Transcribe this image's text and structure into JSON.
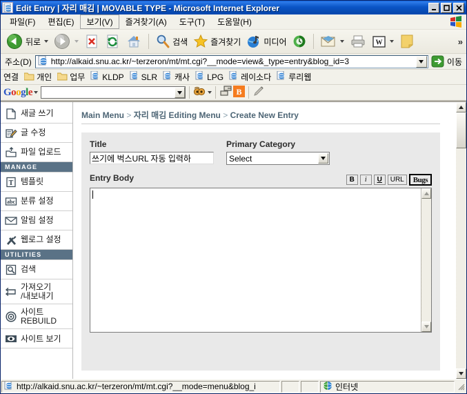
{
  "window": {
    "title": "Edit Entry | 자리 매김 | MOVABLE TYPE - Microsoft Internet Explorer",
    "icon": "ie-page-icon",
    "minimize": "_",
    "maximize": "□",
    "close": "✕"
  },
  "menubar": {
    "items": [
      {
        "label": "파일(F)",
        "selected": false
      },
      {
        "label": "편집(E)",
        "selected": false
      },
      {
        "label": "보기(V)",
        "selected": true
      },
      {
        "label": "즐겨찾기(A)",
        "selected": false
      },
      {
        "label": "도구(T)",
        "selected": false
      },
      {
        "label": "도움말(H)",
        "selected": false
      }
    ]
  },
  "toolbar": {
    "back": "뒤로",
    "forward": "",
    "stop": "",
    "refresh": "",
    "home": "",
    "search": "검색",
    "favorites": "즐겨찾기",
    "media": "미디어",
    "history": "",
    "mail": "",
    "print": "",
    "edit_word": "W",
    "notes": "",
    "overflow": "»"
  },
  "address": {
    "label": "주소(D)",
    "url": "http://alkaid.snu.ac.kr/~terzeron/mt/mt.cgi?__mode=view&_type=entry&blog_id=3",
    "go": "이동"
  },
  "links": {
    "label": "연결",
    "items": [
      {
        "label": "개인",
        "icon": "folder-icon"
      },
      {
        "label": "업무",
        "icon": "folder-icon"
      },
      {
        "label": "KLDP",
        "icon": "ie-page-icon"
      },
      {
        "label": "SLR",
        "icon": "ie-page-icon"
      },
      {
        "label": "캐사",
        "icon": "ie-page-icon"
      },
      {
        "label": "LPG",
        "icon": "ie-page-icon"
      },
      {
        "label": "레이소다",
        "icon": "ie-page-icon"
      },
      {
        "label": "루리웹",
        "icon": "ie-page-icon"
      }
    ]
  },
  "google_toolbar": {
    "brand": "Google",
    "search_value": "",
    "search_placeholder": "",
    "buttons": [
      "popup-blocker-icon",
      "page-rank-icon",
      "blogger-icon",
      "highlight-icon"
    ]
  },
  "sidebar": {
    "items": [
      {
        "label": "새글 쓰기",
        "icon": "new-page-icon",
        "type": "item"
      },
      {
        "label": "글 수정",
        "icon": "edit-pencil-icon",
        "type": "item"
      },
      {
        "label": "파일 업로드",
        "icon": "upload-folder-icon",
        "type": "item"
      },
      {
        "label": "MANAGE",
        "type": "header"
      },
      {
        "label": "템플릿",
        "icon": "template-t-icon",
        "type": "item"
      },
      {
        "label": "분류 설정",
        "icon": "abc-icon",
        "type": "item"
      },
      {
        "label": "알림 설정",
        "icon": "mail-icon",
        "type": "item"
      },
      {
        "label": "웹로그 설정",
        "icon": "tools-icon",
        "type": "item"
      },
      {
        "label": "UTILITIES",
        "type": "header"
      },
      {
        "label": "검색",
        "icon": "magnifier-icon",
        "type": "item"
      },
      {
        "label": "가져오기\n/내보내기",
        "icon": "import-export-icon",
        "type": "item"
      },
      {
        "label": "사이트\nREBUILD",
        "icon": "target-icon",
        "type": "item"
      },
      {
        "label": "사이트 보기",
        "icon": "eye-icon",
        "type": "item"
      }
    ]
  },
  "breadcrumb": {
    "root": "Main Menu",
    "sep1": ">",
    "middle": "자리 매김 Editing Menu",
    "sep2": ">",
    "current": "Create New Entry"
  },
  "form": {
    "title_label": "Title",
    "title_value": "쓰기에 벅스URL 자동 입력하",
    "category_label": "Primary Category",
    "category_value": "Select",
    "body_label": "Entry Body",
    "body_value": "",
    "format_buttons": {
      "bold": "B",
      "italic": "i",
      "underline": "U",
      "url": "URL",
      "bugs": "Bugs"
    }
  },
  "statusbar": {
    "link_url": "http://alkaid.snu.ac.kr/~terzeron/mt/mt.cgi?__mode=menu&blog_i",
    "cell2": "",
    "cell3": "",
    "zone": "인터넷"
  },
  "colors": {
    "title_bar": "#0a55c6",
    "nav_header": "#5a7286",
    "crumb_text": "#4d6575",
    "form_bg": "#e9e9e9",
    "chrome_bg": "#f2f1ea"
  }
}
